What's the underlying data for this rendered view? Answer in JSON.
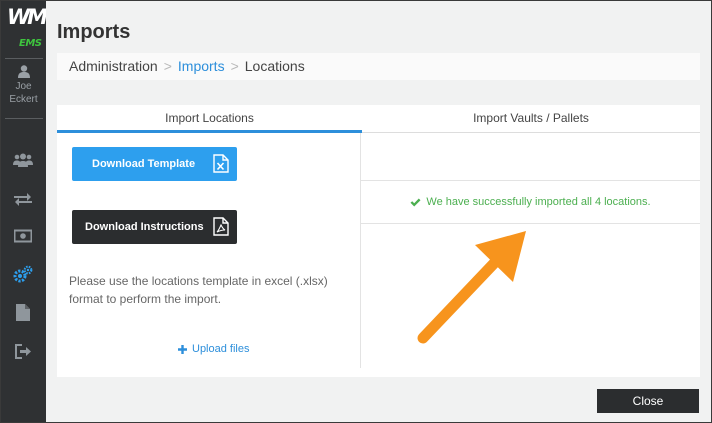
{
  "sidebar": {
    "logo_main": "WM",
    "logo_sub": "EMS",
    "user": {
      "first_name": "Joe",
      "last_name": "Eckert"
    },
    "nav_icons": [
      "users-icon",
      "transfer-icon",
      "money-icon",
      "gears-icon",
      "document-icon",
      "sign-out-icon"
    ]
  },
  "page": {
    "title": "Imports",
    "breadcrumb": [
      "Administration",
      "Imports",
      "Locations"
    ]
  },
  "tabs": {
    "left": "Import Locations",
    "right": "Import Vaults / Pallets"
  },
  "left_panel": {
    "download_template": "Download Template",
    "download_instructions": "Download Instructions",
    "hint": "Please use the locations template in excel (.xlsx) format to perform the import.",
    "upload": "Upload files"
  },
  "right_panel": {
    "success_message": "We have successfully imported all 4 locations."
  },
  "footer": {
    "close": "Close"
  },
  "colors": {
    "accent": "#2d8fdb",
    "success": "#4caf50",
    "annotation_arrow": "#f7941d",
    "sidebar": "#2f3133"
  }
}
